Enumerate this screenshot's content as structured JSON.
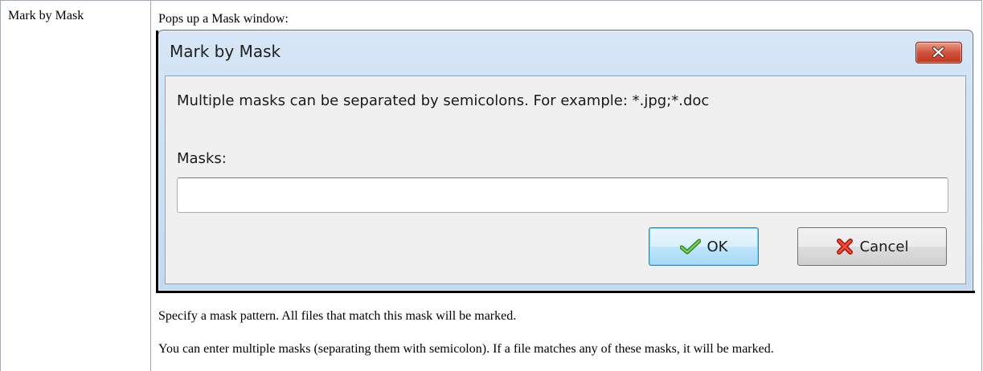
{
  "table": {
    "command": "Mark by Mask",
    "intro": "Pops up a Mask window:",
    "note_1": "Specify a mask pattern. All files that match this mask will be marked.",
    "note_2": "You can enter multiple masks (separating them with semicolon). If a file matches any of these masks, it will be marked."
  },
  "dialog": {
    "title": "Mark by Mask",
    "message": "Multiple masks can be separated by semicolons. For example: *.jpg;*.doc",
    "masks_label": "Masks:",
    "masks_value": "",
    "ok_label": "OK",
    "cancel_label": "Cancel",
    "icons": {
      "close": "close-icon",
      "ok": "checkmark-icon",
      "cancel": "red-x-icon"
    },
    "colors": {
      "titlebar": "#c5d9ef",
      "close_button": "#c0361f",
      "ok_border": "#3c7fb1",
      "checkmark": "#3a9b2a",
      "cancel_x": "#d8271c"
    }
  }
}
